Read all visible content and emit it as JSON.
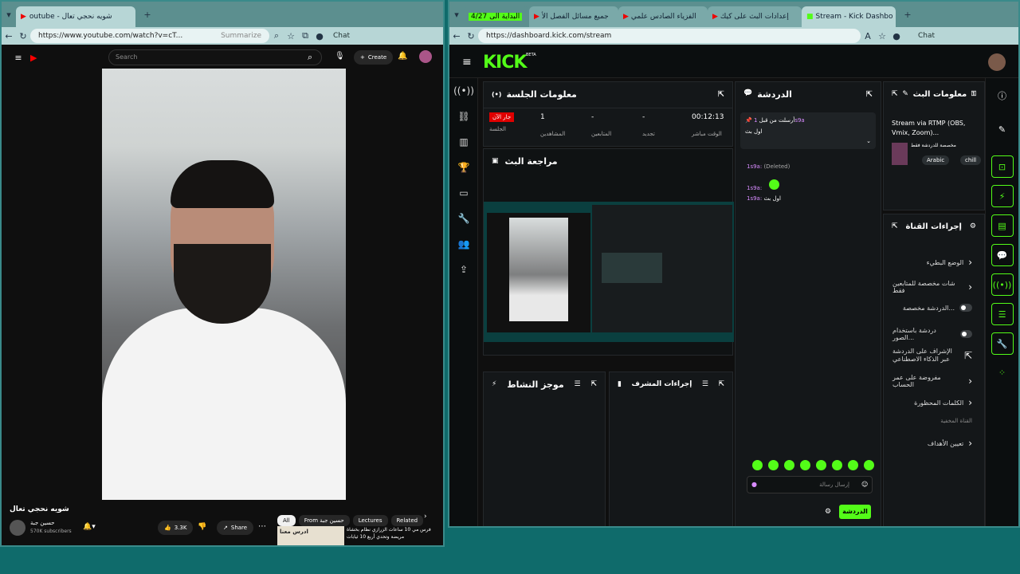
{
  "left_browser": {
    "tab_title": "outube - شويه نحجي تعال",
    "url": "https://www.youtube.com/watch?v=cT...",
    "summarize": "Summarize",
    "chat": "Chat",
    "search_placeholder": "Search",
    "create_label": "Create",
    "video_title": "شويه نحجي تعال",
    "channel_name": "حسين جبة",
    "subscribers": "570K subscribers",
    "likes": "3.3K",
    "share": "Share",
    "chips": [
      "All",
      "From حسين جبة",
      "Lectures",
      "Related"
    ],
    "rec_title_1": "فرس مي 10 ساعات الزرازي نظام بخشاة",
    "rec_title_2": "مريضة وتحدي أربع 10 ثيابات",
    "rec_thumb_text": "ادرس معنا"
  },
  "right_browser": {
    "tabs": [
      "البداية الى 4/27",
      "جميع مسائل الفصل الأ",
      "الفزياء الصادس علمي",
      "إعدادات البث على كيك",
      "Stream - Kick Dashbo"
    ],
    "url": "https://dashboard.kick.com/stream",
    "chat": "Chat"
  },
  "kick": {
    "logo": "KICK",
    "beta": "BETA",
    "session": {
      "title": "معلومات الجلسة",
      "live_badge": "جار الآن",
      "live_label": "الجلسة",
      "viewers_value": "1",
      "viewers_label": "المشاهدين",
      "followers_value": "-",
      "followers_label": "المتابعين",
      "subs_value": "-",
      "subs_label": "تجديد",
      "time_value": "00:12:13",
      "time_label": "الوقت مباشر"
    },
    "preview_title": "مراجعة البث",
    "activity_title": "موجز النشاط",
    "mod_title": "إجراءات المشرف",
    "chat": {
      "title": "الدردشة",
      "pinned_user": "1s9a",
      "pinned_by": "أرسلت من قبل",
      "pinned_msg": "اول بث",
      "msg1_user": "1s9a:",
      "msg1_text": "(Deleted)",
      "msg2_user": "1s9a:",
      "msg3_user": "1s9a:",
      "msg3_text": "اول بث",
      "input_placeholder": "إرسال رسالة",
      "send_label": "الدردشة"
    },
    "stream_info": {
      "title": "معلومات البث",
      "stream_title": "Stream via RTMP (OBS, Vmix, Zoom)...",
      "category": "مخصصة للدردشة فقط",
      "tags": [
        "Arabic",
        "chill"
      ]
    },
    "channel_actions": {
      "title": "إجراءات القناة",
      "items": [
        "الوضع البطيء",
        "شات مخصصة للمتابعين فقط",
        "الدردشة مخصصة...",
        "دردشة باستخدام الصور...",
        "الإشراف على الدردشة عبر الذكاء الاصطناعي",
        "مفروضة على عمر الحساب",
        "الكلمات المحظورة",
        "القناة المخفية",
        "تعيين الأهداف"
      ]
    }
  },
  "colors": {
    "kick_green": "#53fc18",
    "live_red": "#e00000",
    "desktop": "#0f6b6b"
  }
}
